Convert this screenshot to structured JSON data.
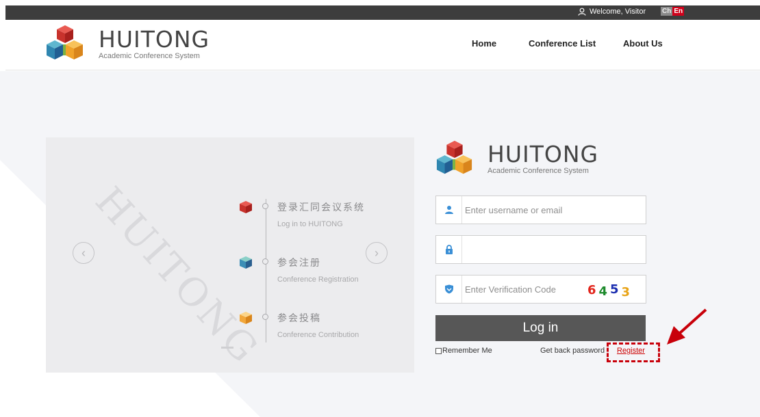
{
  "topbar": {
    "welcome_text": "Welcome, Visitor",
    "lang_ch": "Ch",
    "lang_en": "En"
  },
  "header": {
    "logo_title": "HUITONG",
    "logo_subtitle": "Academic Conference System",
    "nav": [
      {
        "label": "Home"
      },
      {
        "label": "Conference List"
      },
      {
        "label": "About Us"
      }
    ]
  },
  "carousel": {
    "steps": [
      {
        "cn": "登录汇同会议系统",
        "en": "Log in to HUITONG"
      },
      {
        "cn": "参会注册",
        "en": "Conference Registration"
      },
      {
        "cn": "参会投稿",
        "en": "Conference Contribution"
      }
    ],
    "watermark": "HUITONG"
  },
  "login": {
    "logo_title": "HUITONG",
    "logo_subtitle": "Academic Conference System",
    "username_placeholder": "Enter username or email",
    "password_placeholder": "",
    "verification_placeholder": "Enter Verification Code",
    "captcha_digits": [
      "6",
      "4",
      "5",
      "3"
    ],
    "login_button": "Log in",
    "remember_me": "Remember Me",
    "get_back_password": "Get back password",
    "register": "Register"
  },
  "colors": {
    "topbar_bg": "#3d3d3d",
    "lang_active": "#d0021b",
    "button_bg": "#575757",
    "highlight_red": "#c8000a",
    "icon_blue": "#3a8fd6",
    "captcha_colors": [
      "#e2231a",
      "#1d8a2c",
      "#1c2fb0",
      "#e8a418"
    ]
  }
}
